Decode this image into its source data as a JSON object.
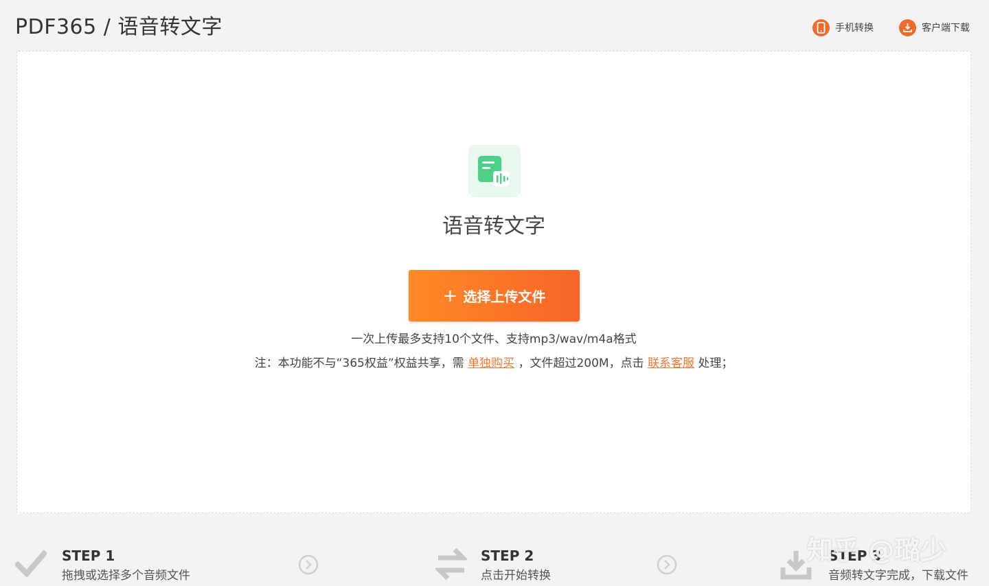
{
  "header": {
    "title": "PDF365 / 语音转文字",
    "links": [
      {
        "label": "手机转换",
        "icon": "mobile-phone-icon"
      },
      {
        "label": "客户端下载",
        "icon": "download-client-icon"
      }
    ]
  },
  "upload": {
    "feature_title": "语音转文字",
    "button_label": "选择上传文件",
    "button_icon": "plus-icon",
    "hint_line1": "一次上传最多支持10个文件、支持mp3/wav/m4a格式",
    "hint_line2": {
      "prefix": "注：本功能不与“365权益”权益共享，需",
      "link1": "单独购买",
      "middle": "，文件超过200M，点击",
      "link2": "联系客服",
      "suffix": "处理；"
    }
  },
  "steps": [
    {
      "title": "STEP 1",
      "desc": "拖拽或选择多个音频文件",
      "icon": "check-icon"
    },
    {
      "title": "STEP 2",
      "desc": "点击开始转换",
      "icon": "swap-arrows-icon"
    },
    {
      "title": "STEP 3",
      "desc": "音频转文字完成，下载文件",
      "icon": "download-tray-icon"
    }
  ],
  "watermark": "知乎 @璐少",
  "colors": {
    "accent": "#f7652a",
    "accent_light": "#ff8a24",
    "feature_green": "#4cd187",
    "link_orange": "#f0762f"
  }
}
